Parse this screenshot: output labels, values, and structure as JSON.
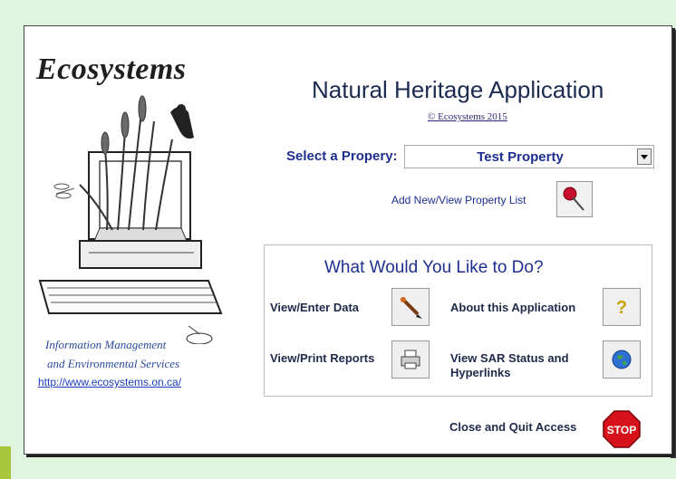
{
  "logo": {
    "title": "Ecosystems",
    "caption_line1": "Information Management",
    "caption_line2": "and Environmental Services",
    "url": "http://www.ecosystems.on.ca/"
  },
  "header": {
    "title": "Natural Heritage Application",
    "copyright": "© Ecosystems 2015"
  },
  "property": {
    "label": "Select a Propery:",
    "value": "Test Property",
    "add_link": "Add New/View Property List"
  },
  "actions": {
    "heading": "What Would You Like to Do?",
    "view_enter": "View/Enter Data",
    "about": "About this Application",
    "view_print": "View/Print Reports",
    "sar_line1": "View SAR Status and",
    "sar_line2": "Hyperlinks"
  },
  "footer": {
    "close_label": "Close and Quit Access",
    "stop_text": "STOP"
  },
  "colors": {
    "background": "#dff5de",
    "label_blue": "#1e2f8f",
    "stop_red": "#d8121b"
  }
}
